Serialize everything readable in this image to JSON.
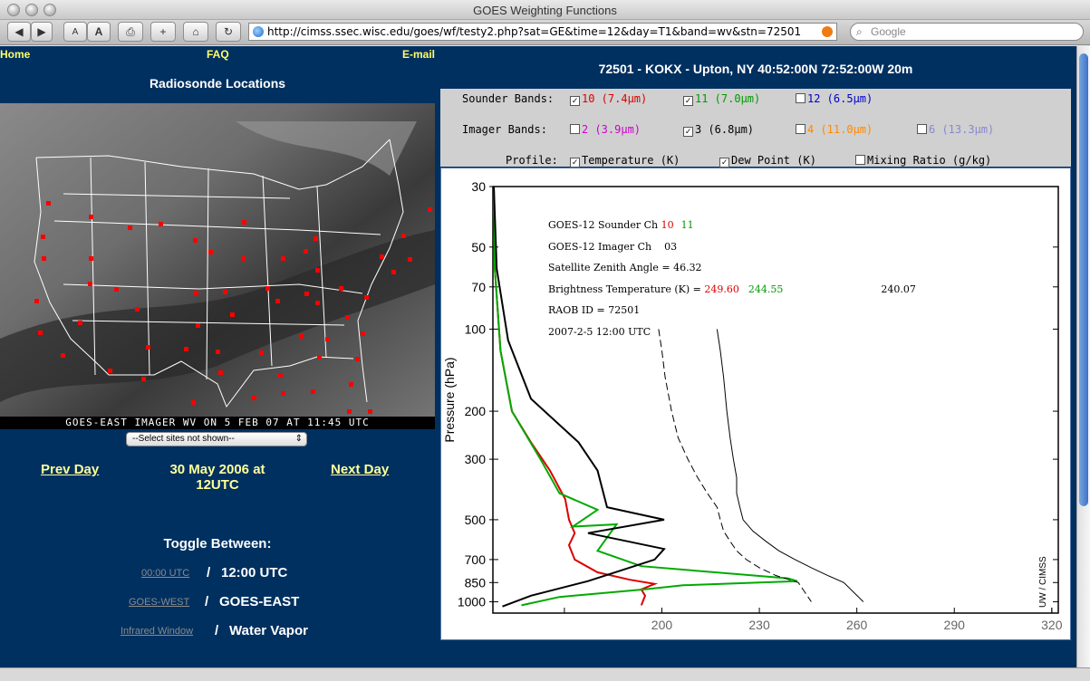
{
  "window": {
    "title": "GOES Weighting Functions",
    "url": "http://cimss.ssec.wisc.edu/goes/wf/testy2.php?sat=GE&time=12&day=T1&band=wv&stn=72501",
    "search_placeholder": "Google"
  },
  "nav": {
    "home": "Home",
    "faq": "FAQ",
    "email": "E-mail"
  },
  "left": {
    "radiosonde_title": "Radiosonde Locations",
    "map_caption": "GOES-EAST IMAGER WV ON 5 FEB 07 AT 11:45 UTC",
    "select_label": "--Select sites not shown--",
    "prev_day": "Prev Day",
    "date_line1": "30 May 2006 at",
    "date_line2": "12UTC",
    "next_day": "Next Day",
    "toggle_title": "Toggle Between:",
    "toggles": [
      {
        "link": "00:00 UTC",
        "sep": "/",
        "current": "12:00 UTC"
      },
      {
        "link": "GOES-WEST",
        "sep": "/",
        "current": "GOES-EAST"
      },
      {
        "link": "Infrared Window",
        "sep": "/",
        "current": "Water Vapor"
      }
    ]
  },
  "station_header": "72501 - KOKX - Upton, NY 40:52:00N 72:52:00W 20m",
  "controls": {
    "sounder_label": "Sounder Bands:",
    "imager_label": "Imager  Bands:",
    "profile_label": "Profile:",
    "sounder": [
      {
        "label": "10 (7.4µm)",
        "checked": true,
        "color": "#dd0000"
      },
      {
        "label": "11 (7.0µm)",
        "checked": true,
        "color": "#009900"
      },
      {
        "label": "12 (6.5µm)",
        "checked": false,
        "color": "#0000cc"
      }
    ],
    "imager": [
      {
        "label": "2 (3.9µm)",
        "checked": false,
        "color": "#cc00cc"
      },
      {
        "label": "3 (6.8µm)",
        "checked": true,
        "color": "#000000"
      },
      {
        "label": "4 (11.0µm)",
        "checked": false,
        "color": "#ff8800"
      },
      {
        "label": "6 (13.3µm)",
        "checked": false,
        "color": "#8888cc"
      }
    ],
    "profile": [
      {
        "label": "Temperature (K)",
        "checked": true
      },
      {
        "label": "Dew Point (K)",
        "checked": true
      },
      {
        "label": "Mixing Ratio (g/kg)",
        "checked": false
      }
    ],
    "check_mark": "✓"
  },
  "plot_text": {
    "sounder_line": "GOES-12 Sounder Ch",
    "sounder_ch_red": "10",
    "sounder_ch_green": "11",
    "imager_line": "GOES-12 Imager  Ch",
    "imager_ch": "03",
    "zenith": "Satellite Zenith Angle = 46.32",
    "bt_label": "Brightness Temperature (K) =",
    "bt_red": "249.60",
    "bt_green": "244.55",
    "bt_black": "240.07",
    "raob": "RAOB ID = 72501",
    "date": "2007-2-5 12:00 UTC",
    "credit": "UW / CIMSS"
  },
  "chart_data": {
    "type": "line",
    "ylabel": "Pressure (hPa)",
    "y_scale": "log-reversed",
    "y_ticks": [
      30,
      50,
      70,
      100,
      200,
      300,
      500,
      700,
      850,
      1000
    ],
    "x_ticks": [
      200,
      230,
      260,
      290,
      320
    ],
    "xlim": [
      148,
      322
    ],
    "ylim": [
      30,
      1100
    ],
    "series": [
      {
        "color": "#dd0000",
        "weighting": true,
        "x": [
          0.005,
          0.01,
          0.04,
          0.1,
          0.2,
          0.3,
          0.38,
          0.4,
          0.43,
          0.4,
          0.43,
          0.55,
          0.72,
          0.85,
          0.78,
          0.8,
          0.78
        ],
        "y": [
          30,
          60,
          120,
          200,
          260,
          330,
          420,
          500,
          560,
          620,
          700,
          780,
          830,
          860,
          900,
          950,
          1030
        ]
      },
      {
        "color": "#00aa00",
        "weighting": true,
        "x": [
          0.005,
          0.01,
          0.04,
          0.1,
          0.25,
          0.35,
          0.55,
          0.42,
          0.65,
          0.55,
          0.78,
          1.55,
          1.6,
          1.0,
          0.8,
          0.35,
          0.15
        ],
        "y": [
          30,
          60,
          120,
          200,
          300,
          400,
          460,
          530,
          520,
          650,
          740,
          820,
          840,
          870,
          900,
          960,
          1030
        ]
      },
      {
        "color": "#000000",
        "weighting": true,
        "x": [
          0.005,
          0.02,
          0.08,
          0.2,
          0.45,
          0.55,
          0.6,
          0.9,
          0.5,
          0.9,
          0.85,
          0.5,
          0.2,
          0.05
        ],
        "y": [
          30,
          60,
          110,
          180,
          260,
          330,
          450,
          500,
          560,
          640,
          700,
          840,
          950,
          1040
        ]
      },
      {
        "name": "Temperature",
        "color": "#000000",
        "dash": false,
        "x": [
          217,
          218,
          219,
          220,
          221,
          222,
          223,
          223,
          224,
          225,
          228,
          232,
          236,
          241,
          246,
          251,
          256,
          262
        ],
        "y": [
          100,
          120,
          150,
          200,
          250,
          300,
          350,
          400,
          450,
          500,
          550,
          600,
          650,
          700,
          750,
          800,
          850,
          1000
        ]
      },
      {
        "name": "Dew Point",
        "color": "#000000",
        "dash": true,
        "x": [
          199,
          200,
          201,
          203,
          205,
          208,
          211,
          214,
          217,
          218,
          219,
          221,
          223,
          226,
          230,
          235,
          242,
          246
        ],
        "y": [
          100,
          120,
          150,
          200,
          250,
          300,
          350,
          400,
          450,
          500,
          550,
          600,
          650,
          700,
          750,
          800,
          850,
          1000
        ]
      }
    ]
  }
}
